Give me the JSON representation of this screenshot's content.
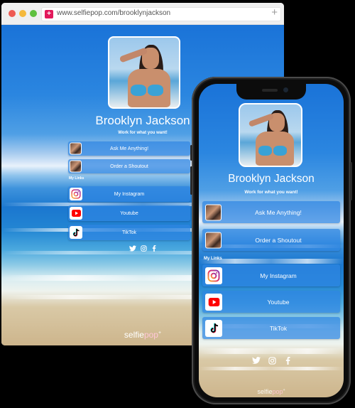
{
  "browser": {
    "url": "www.selfiepop.com/brooklynjackson",
    "favicon_glyph": "+",
    "new_tab_glyph": "+"
  },
  "profile": {
    "name": "Brooklyn Jackson",
    "tagline": "Work for what you want!"
  },
  "services": [
    {
      "label": "Ask Me Anything!"
    },
    {
      "label": "Order a Shoutout"
    }
  ],
  "my_links_label": "My Links",
  "links": [
    {
      "label": "My Instagram",
      "icon": "instagram-icon"
    },
    {
      "label": "Youtube",
      "icon": "youtube-icon"
    },
    {
      "label": "TikTok",
      "icon": "tiktok-icon"
    }
  ],
  "social_icons": [
    "twitter-icon",
    "instagram-icon",
    "facebook-icon"
  ],
  "brand": {
    "prefix": "selfie",
    "suffix": "pop",
    "mark": "+"
  },
  "colors": {
    "sky": "#1a73d8",
    "button": "#2e85e2",
    "favicon": "#e2195b"
  }
}
